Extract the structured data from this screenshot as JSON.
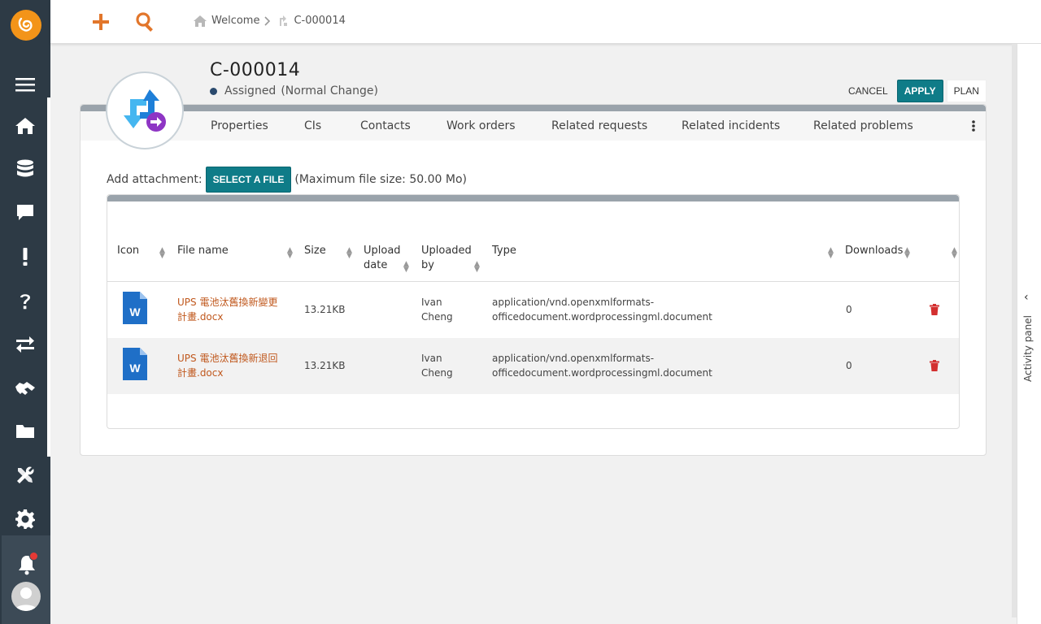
{
  "nav": {
    "logo_icon": "orange-swirl-logo",
    "items": [
      {
        "name": "home-icon"
      },
      {
        "name": "database-icon"
      },
      {
        "name": "chat-icon"
      },
      {
        "name": "exclamation-icon"
      },
      {
        "name": "question-icon"
      },
      {
        "name": "transfer-icon"
      },
      {
        "name": "handshake-icon"
      },
      {
        "name": "folder-icon"
      },
      {
        "name": "tools-icon"
      },
      {
        "name": "gear-icon"
      }
    ]
  },
  "header": {
    "breadcrumb": [
      "Welcome",
      "C-000014"
    ]
  },
  "record": {
    "title": "C-000014",
    "status": "Assigned",
    "type": "(Normal Change)"
  },
  "actions": {
    "cancel": "CANCEL",
    "apply": "APPLY",
    "plan": "PLAN"
  },
  "tabs": [
    "Properties",
    "CIs",
    "Contacts",
    "Work orders",
    "Related requests",
    "Related incidents",
    "Related problems"
  ],
  "attachment": {
    "label": "Add attachment:",
    "button": "SELECT A FILE",
    "note": "(Maximum file size: 50.00 Mo)"
  },
  "table": {
    "columns": [
      "Icon",
      "File name",
      "Size",
      "Upload date",
      "Uploaded by",
      "Type",
      "Downloads"
    ],
    "rows": [
      {
        "icon": "word-doc-icon",
        "file_name": "UPS 電池汰舊換新變更計畫.docx",
        "size": "13.21KB",
        "upload_date": "",
        "uploaded_by": "Ivan Cheng",
        "type": "application/vnd.openxmlformats-officedocument.wordprocessingml.document",
        "downloads": "0"
      },
      {
        "icon": "word-doc-icon",
        "file_name": "UPS 電池汰舊換新退回計畫.docx",
        "size": "13.21KB",
        "upload_date": "",
        "uploaded_by": "Ivan Cheng",
        "type": "application/vnd.openxmlformats-officedocument.wordprocessingml.document",
        "downloads": "0"
      }
    ]
  },
  "activity_panel": {
    "label": "Activity panel"
  },
  "colors": {
    "accent": "#0f7c88",
    "orange": "#e2762b",
    "sidebar": "#2d3a45",
    "link": "#c0581d",
    "delete": "#d32f2f"
  }
}
